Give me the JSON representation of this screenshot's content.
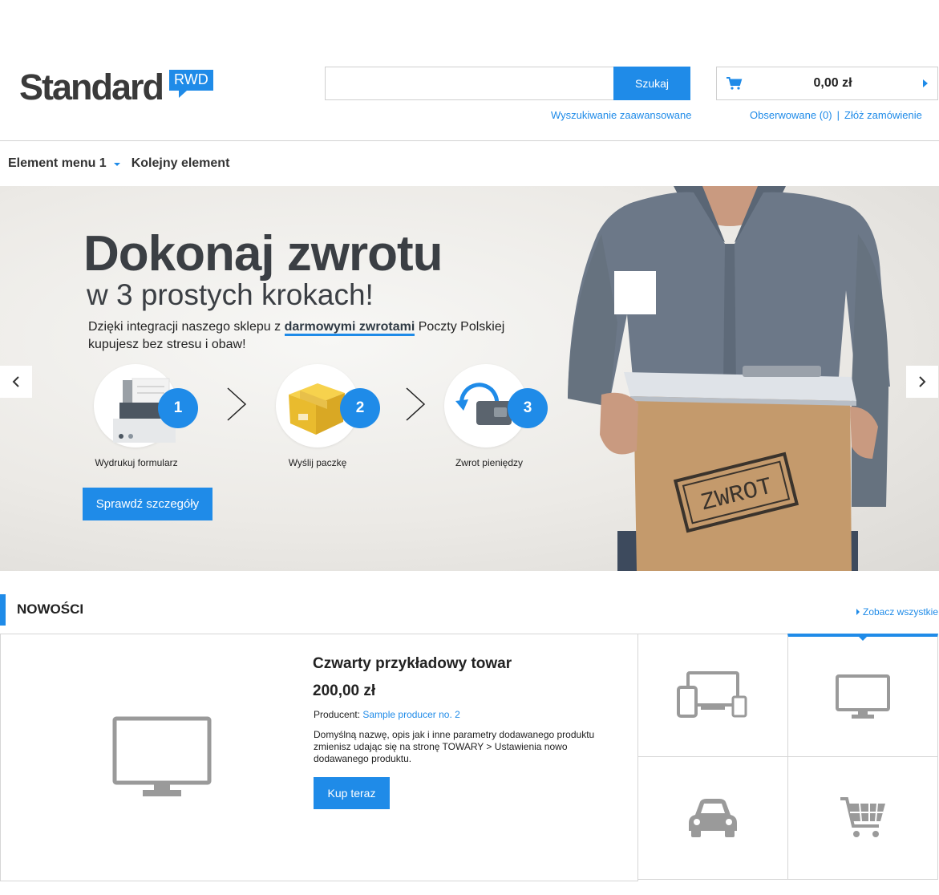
{
  "header": {
    "logo_text": "Standard",
    "logo_badge": "RWD",
    "search_button": "Szukaj",
    "search_placeholder": "",
    "advanced_search": "Wyszukiwanie zaawansowane",
    "cart_total": "0,00 zł",
    "observed_link": "Obserwowane (0)",
    "link_separator": "|",
    "order_link": "Złóż zamówienie"
  },
  "nav": {
    "items": [
      {
        "label": "Element menu 1",
        "has_dropdown": true
      },
      {
        "label": "Kolejny element",
        "has_dropdown": false
      }
    ]
  },
  "hero": {
    "title": "Dokonaj zwrotu",
    "subtitle": "w 3 prostych krokach!",
    "desc_prefix": "Dzięki integracji naszego sklepu z ",
    "desc_highlight": "darmowymi zwrotami",
    "desc_suffix": " Poczty Polskiej",
    "desc_line2": "kupujesz bez stresu i obaw!",
    "steps": [
      {
        "number": "1",
        "label": "Wydrukuj formularz",
        "icon": "printer-icon"
      },
      {
        "number": "2",
        "label": "Wyślij paczkę",
        "icon": "package-icon"
      },
      {
        "number": "3",
        "label": "Zwrot pieniędzy",
        "icon": "wallet-refund-icon"
      }
    ],
    "cta": "Sprawdź szczegóły",
    "stamp_text": "ZWROT"
  },
  "news": {
    "title": "NOWOŚCI",
    "see_all": "Zobacz wszystkie",
    "product": {
      "name": "Czwarty przykładowy towar",
      "price": "200,00 zł",
      "producer_label": "Producent: ",
      "producer_name": "Sample producer no. 2",
      "description": "Domyślną nazwę, opis jak i inne parametry dodawanego produktu zmienisz udając się na stronę TOWARY > Ustawienia nowo dodawanego produktu.",
      "buy_button": "Kup teraz",
      "image_icon": "monitor-icon"
    },
    "thumbnails": [
      {
        "icon": "devices-icon",
        "active": false
      },
      {
        "icon": "monitor-icon",
        "active": true
      },
      {
        "icon": "car-icon",
        "active": false
      },
      {
        "icon": "shopping-cart-icon",
        "active": false
      }
    ]
  },
  "colors": {
    "accent": "#1f8be8",
    "logo": "#3a3a3a",
    "icon_gray": "#9a9a9a"
  }
}
